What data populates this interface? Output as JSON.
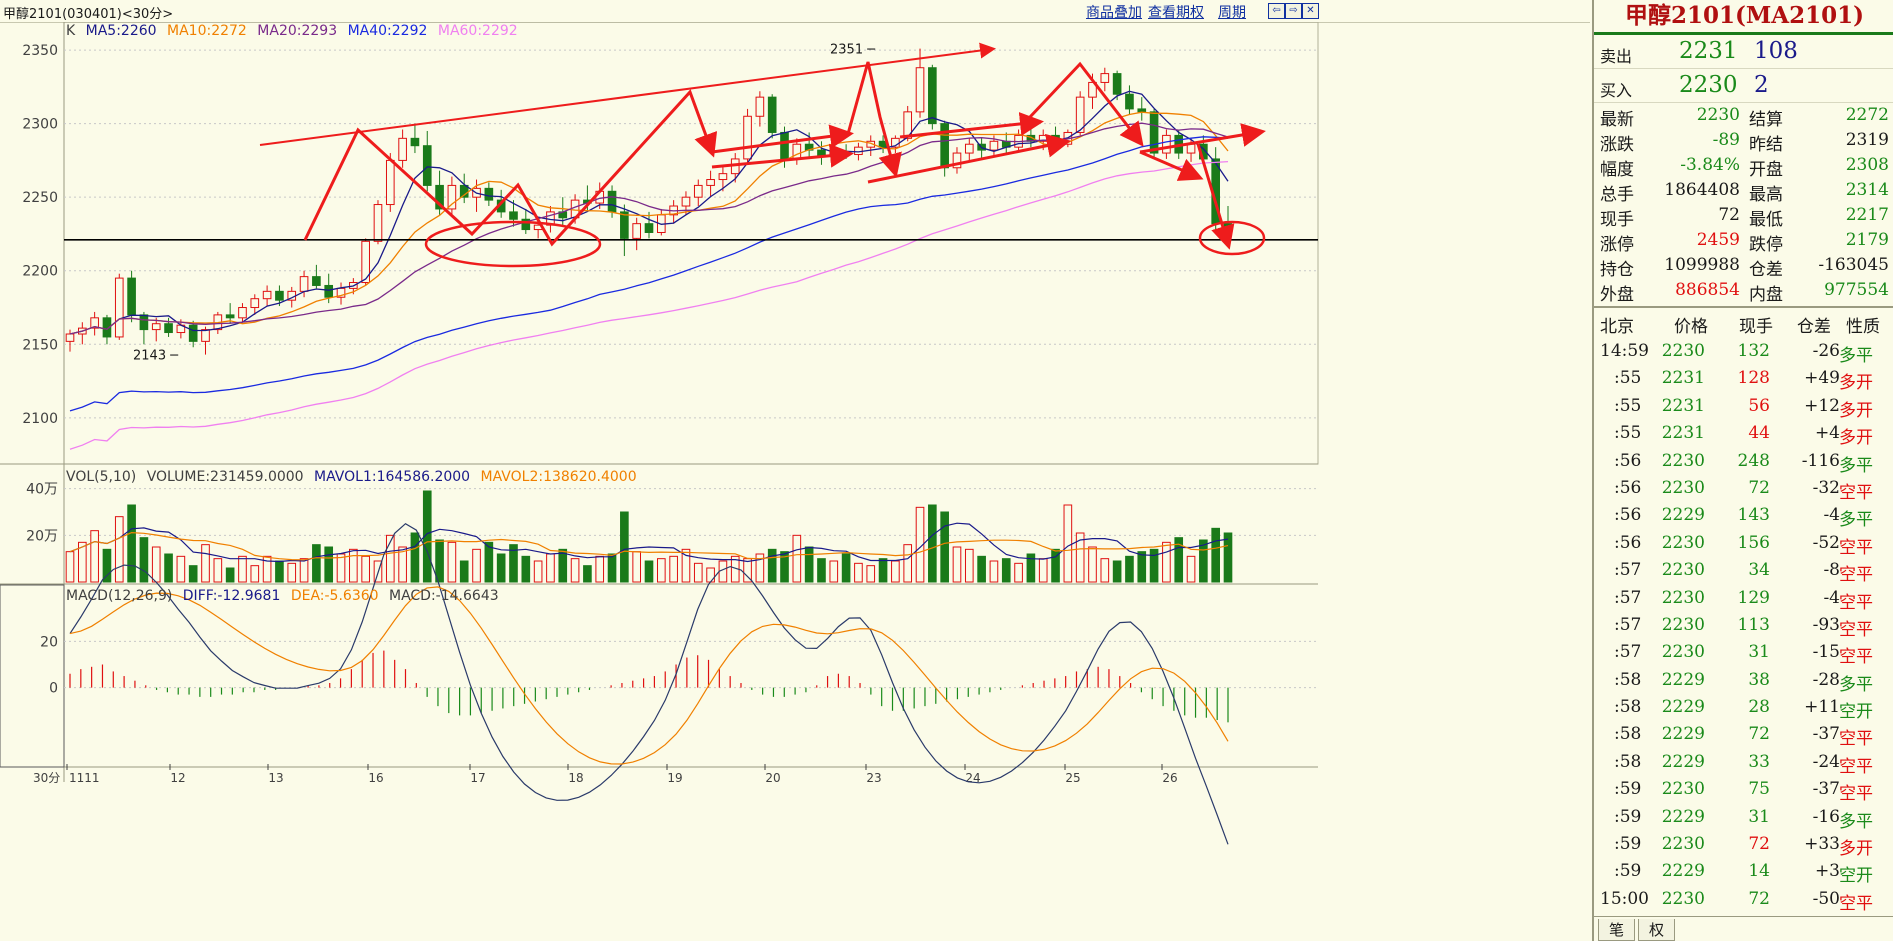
{
  "header": {
    "title": "甲醇2101(030401)<30分>",
    "links": [
      "商品叠加",
      "查看期权",
      "周期"
    ],
    "icons": [
      "window-left-icon",
      "window-right-icon",
      "close-icon"
    ]
  },
  "chart_data": [
    {
      "type": "candlestick",
      "label": "K",
      "ma_legend": [
        {
          "name": "MA5",
          "value": "MA5:2260",
          "color": "#1a1a8a"
        },
        {
          "name": "MA10",
          "value": "MA10:2272",
          "color": "#f08000"
        },
        {
          "name": "MA20",
          "value": "MA20:2293",
          "color": "#7a2a8a"
        },
        {
          "name": "MA40",
          "value": "MA40:2292",
          "color": "#1a2ae0"
        },
        {
          "name": "MA60",
          "value": "MA60:2292",
          "color": "#f080f0"
        }
      ],
      "ylim": [
        2070,
        2365
      ],
      "y_ticks": [
        "2350",
        "2300",
        "2250",
        "2200",
        "2150",
        "2100"
      ],
      "x_ticks": [
        "1111",
        "12",
        "13",
        "16",
        "17",
        "18",
        "19",
        "20",
        "23",
        "24",
        "25",
        "26"
      ],
      "x_axis_label": "30分",
      "annotations": {
        "high": "2351",
        "low": "2143"
      },
      "support_level": 2221,
      "candles": [
        [
          2152,
          2160,
          2145,
          2157
        ],
        [
          2157,
          2165,
          2150,
          2161
        ],
        [
          2161,
          2172,
          2156,
          2168
        ],
        [
          2168,
          2170,
          2150,
          2155
        ],
        [
          2155,
          2198,
          2153,
          2195
        ],
        [
          2195,
          2200,
          2165,
          2170
        ],
        [
          2170,
          2172,
          2150,
          2160
        ],
        [
          2160,
          2168,
          2152,
          2164
        ],
        [
          2164,
          2168,
          2155,
          2158
        ],
        [
          2158,
          2167,
          2154,
          2163
        ],
        [
          2163,
          2166,
          2148,
          2152
        ],
        [
          2152,
          2162,
          2143,
          2160
        ],
        [
          2160,
          2172,
          2157,
          2170
        ],
        [
          2170,
          2178,
          2164,
          2168
        ],
        [
          2168,
          2178,
          2165,
          2175
        ],
        [
          2175,
          2184,
          2170,
          2181
        ],
        [
          2181,
          2190,
          2176,
          2186
        ],
        [
          2186,
          2190,
          2176,
          2180
        ],
        [
          2180,
          2189,
          2175,
          2186
        ],
        [
          2186,
          2200,
          2182,
          2196
        ],
        [
          2196,
          2204,
          2188,
          2190
        ],
        [
          2190,
          2198,
          2178,
          2182
        ],
        [
          2182,
          2192,
          2177,
          2188
        ],
        [
          2188,
          2195,
          2184,
          2192
        ],
        [
          2192,
          2222,
          2190,
          2220
        ],
        [
          2220,
          2248,
          2218,
          2245
        ],
        [
          2245,
          2280,
          2240,
          2275
        ],
        [
          2275,
          2296,
          2270,
          2290
        ],
        [
          2290,
          2300,
          2280,
          2285
        ],
        [
          2285,
          2295,
          2254,
          2258
        ],
        [
          2258,
          2268,
          2238,
          2242
        ],
        [
          2242,
          2264,
          2238,
          2258
        ],
        [
          2258,
          2266,
          2246,
          2250
        ],
        [
          2250,
          2262,
          2240,
          2256
        ],
        [
          2256,
          2260,
          2244,
          2248
        ],
        [
          2248,
          2255,
          2236,
          2240
        ],
        [
          2240,
          2248,
          2230,
          2235
        ],
        [
          2235,
          2242,
          2225,
          2228
        ],
        [
          2228,
          2236,
          2222,
          2231
        ],
        [
          2231,
          2244,
          2226,
          2240
        ],
        [
          2240,
          2250,
          2230,
          2236
        ],
        [
          2236,
          2252,
          2232,
          2248
        ],
        [
          2248,
          2258,
          2240,
          2246
        ],
        [
          2246,
          2260,
          2242,
          2254
        ],
        [
          2254,
          2258,
          2236,
          2240
        ],
        [
          2240,
          2245,
          2210,
          2222
        ],
        [
          2222,
          2236,
          2214,
          2232
        ],
        [
          2232,
          2240,
          2222,
          2226
        ],
        [
          2226,
          2242,
          2224,
          2238
        ],
        [
          2238,
          2248,
          2232,
          2244
        ],
        [
          2244,
          2254,
          2238,
          2250
        ],
        [
          2250,
          2262,
          2244,
          2258
        ],
        [
          2258,
          2268,
          2250,
          2262
        ],
        [
          2262,
          2272,
          2254,
          2266
        ],
        [
          2266,
          2280,
          2260,
          2276
        ],
        [
          2276,
          2310,
          2272,
          2305
        ],
        [
          2305,
          2322,
          2298,
          2318
        ],
        [
          2318,
          2320,
          2290,
          2294
        ],
        [
          2294,
          2298,
          2270,
          2276
        ],
        [
          2276,
          2290,
          2272,
          2286
        ],
        [
          2286,
          2294,
          2276,
          2282
        ],
        [
          2282,
          2288,
          2272,
          2278
        ],
        [
          2278,
          2285,
          2274,
          2281
        ],
        [
          2281,
          2286,
          2276,
          2279
        ],
        [
          2279,
          2287,
          2275,
          2284
        ],
        [
          2284,
          2292,
          2278,
          2288
        ],
        [
          2288,
          2292,
          2280,
          2284
        ],
        [
          2284,
          2292,
          2280,
          2290
        ],
        [
          2290,
          2312,
          2288,
          2308
        ],
        [
          2308,
          2351,
          2304,
          2338
        ],
        [
          2338,
          2340,
          2296,
          2300
        ],
        [
          2300,
          2302,
          2264,
          2270
        ],
        [
          2270,
          2284,
          2266,
          2280
        ],
        [
          2280,
          2290,
          2274,
          2286
        ],
        [
          2286,
          2290,
          2276,
          2282
        ],
        [
          2282,
          2292,
          2278,
          2288
        ],
        [
          2288,
          2294,
          2280,
          2284
        ],
        [
          2284,
          2296,
          2282,
          2292
        ],
        [
          2292,
          2300,
          2284,
          2288
        ],
        [
          2288,
          2296,
          2282,
          2292
        ],
        [
          2292,
          2298,
          2284,
          2286
        ],
        [
          2286,
          2296,
          2284,
          2294
        ],
        [
          2294,
          2322,
          2292,
          2318
        ],
        [
          2318,
          2334,
          2310,
          2328
        ],
        [
          2328,
          2338,
          2322,
          2334
        ],
        [
          2334,
          2336,
          2316,
          2320
        ],
        [
          2320,
          2326,
          2306,
          2310
        ],
        [
          2310,
          2318,
          2302,
          2308
        ],
        [
          2308,
          2310,
          2276,
          2280
        ],
        [
          2280,
          2296,
          2276,
          2292
        ],
        [
          2292,
          2296,
          2276,
          2280
        ],
        [
          2280,
          2290,
          2274,
          2286
        ],
        [
          2286,
          2292,
          2272,
          2276
        ],
        [
          2276,
          2284,
          2226,
          2232
        ],
        [
          2232,
          2244,
          2219,
          2230
        ]
      ]
    },
    {
      "type": "bar",
      "legend": [
        {
          "text": "VOL(5,10)",
          "color": "#404040"
        },
        {
          "text": "VOLUME:231459.0000",
          "color": "#404040"
        },
        {
          "text": "MAVOL1:164586.2000",
          "color": "#1a1a8a"
        },
        {
          "text": "MAVOL2:138620.4000",
          "color": "#f08000"
        }
      ],
      "y_ticks": [
        "40万",
        "20万"
      ],
      "ylim": [
        0,
        420000
      ],
      "values": [
        130,
        170,
        220,
        140,
        280,
        330,
        190,
        150,
        120,
        110,
        70,
        160,
        100,
        60,
        110,
        70,
        110,
        90,
        80,
        100,
        160,
        150,
        120,
        140,
        110,
        90,
        200,
        150,
        210,
        390,
        180,
        170,
        90,
        140,
        170,
        120,
        160,
        110,
        90,
        120,
        140,
        100,
        70,
        110,
        120,
        300,
        130,
        90,
        100,
        110,
        140,
        80,
        60,
        90,
        110,
        100,
        120,
        140,
        130,
        200,
        150,
        100,
        90,
        120,
        80,
        70,
        100,
        90,
        160,
        320,
        330,
        300,
        150,
        140,
        110,
        90,
        100,
        80,
        120,
        100,
        140,
        330,
        210,
        150,
        100,
        90,
        110,
        130,
        140,
        170,
        190,
        110,
        180,
        230,
        210
      ]
    },
    {
      "type": "bar",
      "legend": [
        {
          "text": "MACD(12,26,9)",
          "color": "#404040"
        },
        {
          "text": "DIFF:-12.9681",
          "color": "#1a1a8a"
        },
        {
          "text": "DEA:-5.6360",
          "color": "#f08000"
        },
        {
          "text": "MACD:-14.6643",
          "color": "#404040"
        }
      ],
      "y_ticks": [
        "20",
        "0"
      ],
      "ylim": [
        -33,
        37
      ],
      "values": [
        6,
        8,
        9,
        10,
        7,
        5,
        3,
        1,
        -1,
        -2,
        -3,
        -3,
        -4,
        -4,
        -3,
        -3,
        -2,
        -2,
        -1,
        -1,
        0,
        0,
        1,
        1,
        2,
        4,
        8,
        12,
        15,
        16,
        12,
        8,
        2,
        -4,
        -8,
        -11,
        -12,
        -12,
        -11,
        -10,
        -9,
        -8,
        -7,
        -6,
        -5,
        -4,
        -3,
        -2,
        -1,
        0,
        1,
        2,
        3,
        4,
        5,
        7,
        10,
        13,
        14,
        12,
        8,
        5,
        2,
        -1,
        -3,
        -4,
        -4,
        -3,
        -2,
        1,
        5,
        6,
        5,
        2,
        -3,
        -8,
        -10,
        -10,
        -9,
        -8,
        -7,
        -6,
        -5,
        -4,
        -3,
        -2,
        -1,
        0,
        1,
        2,
        3,
        4,
        5,
        7,
        8,
        9,
        8,
        5,
        2,
        -2,
        -5,
        -8,
        -10,
        -12,
        -13,
        -13,
        -14,
        -15
      ]
    }
  ],
  "right_panel": {
    "title": "甲醇2101(MA2101)",
    "orderbook": [
      {
        "label": "卖出",
        "price": "2231",
        "vol": "108"
      },
      {
        "label": "买入",
        "price": "2230",
        "vol": "2"
      }
    ],
    "quote": [
      {
        "l1": "最新",
        "v1": "2230",
        "c1": "green",
        "l2": "结算",
        "v2": "2272",
        "c2": "green"
      },
      {
        "l1": "涨跌",
        "v1": "-89",
        "c1": "green",
        "l2": "昨结",
        "v2": "2319",
        "c2": "black"
      },
      {
        "l1": "幅度",
        "v1": "-3.84%",
        "c1": "green",
        "l2": "开盘",
        "v2": "2308",
        "c2": "green"
      },
      {
        "l1": "总手",
        "v1": "1864408",
        "c1": "black",
        "l2": "最高",
        "v2": "2314",
        "c2": "green"
      },
      {
        "l1": "现手",
        "v1": "72",
        "c1": "black",
        "l2": "最低",
        "v2": "2217",
        "c2": "green"
      },
      {
        "l1": "涨停",
        "v1": "2459",
        "c1": "red",
        "l2": "跌停",
        "v2": "2179",
        "c2": "green"
      },
      {
        "l1": "持仓",
        "v1": "1099988",
        "c1": "black",
        "l2": "仓差",
        "v2": "-163045",
        "c2": "black"
      },
      {
        "l1": "外盘",
        "v1": "886854",
        "c1": "red",
        "l2": "内盘",
        "v2": "977554",
        "c2": "green"
      }
    ],
    "trades_header": [
      "北京",
      "价格",
      "现手",
      "仓差",
      "性质"
    ],
    "trades": [
      {
        "t": "14:59",
        "p": "2230",
        "v": "132",
        "d": "-26",
        "k": "多平",
        "kc": "green"
      },
      {
        "t": ":55",
        "p": "2231",
        "v": "128",
        "d": "+49",
        "k": "多开",
        "kc": "red"
      },
      {
        "t": ":55",
        "p": "2231",
        "v": "56",
        "d": "+12",
        "k": "多开",
        "kc": "red"
      },
      {
        "t": ":55",
        "p": "2231",
        "v": "44",
        "d": "+4",
        "k": "多开",
        "kc": "red"
      },
      {
        "t": ":56",
        "p": "2230",
        "v": "248",
        "d": "-116",
        "k": "多平",
        "kc": "green"
      },
      {
        "t": ":56",
        "p": "2230",
        "v": "72",
        "d": "-32",
        "k": "空平",
        "kc": "red"
      },
      {
        "t": ":56",
        "p": "2229",
        "v": "143",
        "d": "-4",
        "k": "多平",
        "kc": "green"
      },
      {
        "t": ":56",
        "p": "2230",
        "v": "156",
        "d": "-52",
        "k": "空平",
        "kc": "red"
      },
      {
        "t": ":57",
        "p": "2230",
        "v": "34",
        "d": "-8",
        "k": "空平",
        "kc": "red"
      },
      {
        "t": ":57",
        "p": "2230",
        "v": "129",
        "d": "-4",
        "k": "空平",
        "kc": "red"
      },
      {
        "t": ":57",
        "p": "2230",
        "v": "113",
        "d": "-93",
        "k": "空平",
        "kc": "red"
      },
      {
        "t": ":57",
        "p": "2230",
        "v": "31",
        "d": "-15",
        "k": "空平",
        "kc": "red"
      },
      {
        "t": ":58",
        "p": "2229",
        "v": "38",
        "d": "-28",
        "k": "多平",
        "kc": "green"
      },
      {
        "t": ":58",
        "p": "2229",
        "v": "28",
        "d": "+11",
        "k": "空开",
        "kc": "green"
      },
      {
        "t": ":58",
        "p": "2229",
        "v": "72",
        "d": "-37",
        "k": "空平",
        "kc": "red"
      },
      {
        "t": ":58",
        "p": "2229",
        "v": "33",
        "d": "-24",
        "k": "空平",
        "kc": "red"
      },
      {
        "t": ":59",
        "p": "2230",
        "v": "75",
        "d": "-37",
        "k": "空平",
        "kc": "red"
      },
      {
        "t": ":59",
        "p": "2229",
        "v": "31",
        "d": "-16",
        "k": "多平",
        "kc": "green"
      },
      {
        "t": ":59",
        "p": "2230",
        "v": "72",
        "d": "+33",
        "k": "多开",
        "kc": "red"
      },
      {
        "t": ":59",
        "p": "2229",
        "v": "14",
        "d": "+3",
        "k": "空开",
        "kc": "green"
      },
      {
        "t": "15:00",
        "p": "2230",
        "v": "72",
        "d": "-50",
        "k": "空平",
        "kc": "red"
      }
    ],
    "tabs": [
      "笔",
      "权"
    ]
  }
}
